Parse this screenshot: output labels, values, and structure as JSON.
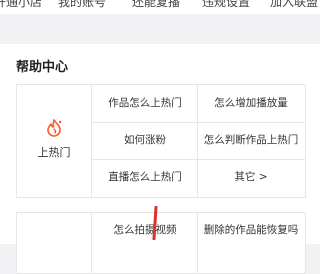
{
  "top_tabs": [
    "开通小店",
    "我的账号",
    "还能复播",
    "违规设置",
    "加入联盟"
  ],
  "help": {
    "title": "帮助中心",
    "group1": {
      "icon": "fire-icon",
      "label": "上热门",
      "items": [
        "作品怎么上热门",
        "怎么增加播放量",
        "如何涨粉",
        "怎么判断作品上热门",
        "直播怎么上热门",
        "其它 >"
      ]
    },
    "group2": {
      "items": [
        "怎么拍摄视频",
        "删除的作品能恢复吗"
      ]
    }
  },
  "accent_color": "#fe5a2b"
}
